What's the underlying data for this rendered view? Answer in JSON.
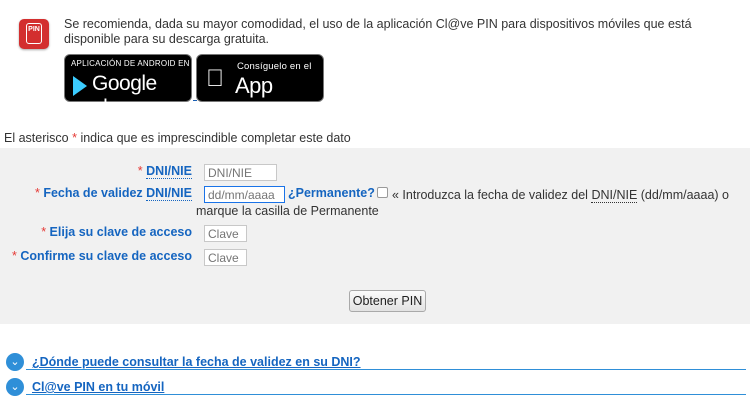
{
  "intro": {
    "text": "Se recomienda, dada su mayor comodidad, el uso de la aplicación Cl@ve PIN para dispositivos móviles que está disponible para su descarga gratuita.",
    "app_icon": "clave-pin-app-icon",
    "app_icon_text": "PIN"
  },
  "badges": {
    "google_small": "APLICACIÓN DE ANDROID EN",
    "google_big": "Google play",
    "apple_small": "Consíguelo en el",
    "apple_big": "App Store"
  },
  "note": {
    "prefix": "El asterisco ",
    "asterisk": "*",
    "suffix": " indica que es imprescindible completar este dato"
  },
  "form": {
    "asterisk": "*",
    "dni_label": "DNI/NIE",
    "dni_placeholder": "DNI/NIE",
    "fecha_label_prefix": "Fecha de validez ",
    "fecha_label_abbr": "DNI/NIE",
    "fecha_placeholder": "dd/mm/aaaa",
    "permanente_label": "¿Permanente?",
    "help_line1_prefix": "« Introduzca la fecha de validez del ",
    "help_line1_abbr": "DNI/NIE",
    "help_line1_suffix": " (dd/mm/aaaa) o",
    "help_line2": "marque la casilla de Permanente",
    "clave_label": "Elija su clave de acceso",
    "clave_placeholder": "Clave",
    "confirm_label": "Confirme su clave de acceso",
    "confirm_placeholder": "Clave",
    "submit_label": "Obtener PIN"
  },
  "accordion": [
    {
      "label": "¿Dónde puede consultar la fecha de validez en su DNI?",
      "icon": "chevron-down-icon"
    },
    {
      "label": "Cl@ve PIN en tu móvil",
      "icon": "chevron-down-icon"
    }
  ],
  "colors": {
    "accent": "#1565c0",
    "required": "#e53935",
    "panel": "#f1f1f1",
    "accordion": "#2f8fd8"
  }
}
